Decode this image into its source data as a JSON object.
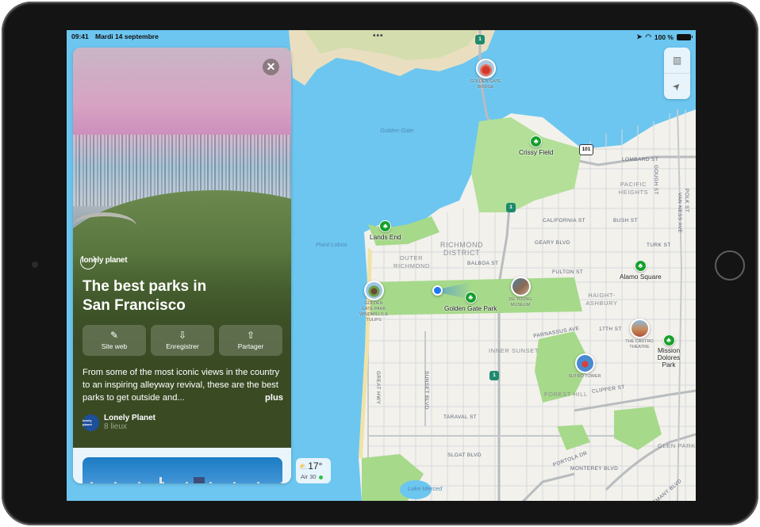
{
  "status_bar": {
    "time": "09:41",
    "date": "Mardi 14 septembre",
    "battery": "100 %",
    "icons": [
      "location-arrow-icon",
      "wifi-icon",
      "battery-icon"
    ]
  },
  "card": {
    "publisher_logo": "lonely planet",
    "title_line1": "The best parks in",
    "title_line2": "San Francisco",
    "close_label": "✕",
    "actions": [
      {
        "label": "Site web",
        "icon": "compass-icon",
        "glyph": "✎"
      },
      {
        "label": "Enregistrer",
        "icon": "save-icon",
        "glyph": "⇩"
      },
      {
        "label": "Partager",
        "icon": "share-icon",
        "glyph": "⇧"
      }
    ],
    "description": "From some of the most iconic views in the country to an inspiring alleyway revival, these are the best parks to get outside and...",
    "more_label": "plus",
    "author": {
      "name": "Lonely Planet",
      "subtitle": "8 lieux",
      "avatar_text": "lonely planet"
    }
  },
  "map_controls": {
    "map_glyph": "▥",
    "location_glyph": "➤"
  },
  "weather": {
    "icon": "partly-sunny-icon",
    "glyph": "⛅",
    "temp": "17°",
    "air": "Air 30",
    "aq_color": "#2fc24b"
  },
  "map": {
    "parks": [
      {
        "name": "Crissy Field"
      },
      {
        "name": "Lands End"
      },
      {
        "name": "Golden Gate Park"
      },
      {
        "name": "Alamo Square"
      },
      {
        "name": "Mission Dolores Park"
      }
    ],
    "landmarks": [
      {
        "name": "GOLDEN GATE BRIDGE"
      },
      {
        "name": "GOLDEN GATE PARK WINDMILLS & TULIPS"
      },
      {
        "name": "DE YOUNG MUSEUM"
      },
      {
        "name": "THE CASTRO THEATRE"
      },
      {
        "name": "SUTRO TOWER"
      }
    ],
    "districts": [
      "RICHMOND DISTRICT",
      "OUTER RICHMOND",
      "PACIFIC HEIGHTS",
      "HAIGHT-ASHBURY",
      "INNER SUNSET",
      "FOREST HILL",
      "GLEN PARK"
    ],
    "water": [
      "Golden Gate",
      "Point Lobos",
      "Lake Merced"
    ],
    "streets": [
      "LOMBARD ST",
      "GOUGH ST",
      "POLK ST",
      "VAN NESS AVE",
      "CALIFORNIA ST",
      "GEARY BLVD",
      "BUSH ST",
      "BALBOA ST",
      "TURK ST",
      "FULTON ST",
      "PARNASSUS AVE",
      "17TH ST",
      "CLIPPER ST",
      "GREAT HWY",
      "SUNSET BLVD",
      "TARAVAL ST",
      "PORTOLA DR",
      "SLOAT BLVD",
      "MONTEREY BLVD",
      "ALEMANY BLVD"
    ],
    "route_shields": [
      "1",
      "101"
    ],
    "park_glyph": "♣"
  },
  "colors": {
    "water": "#6cc6f0",
    "park": "#a6d98a",
    "land": "#f2f1ec",
    "park_pin": "#16a02b",
    "card_green": "#3a4b24"
  }
}
